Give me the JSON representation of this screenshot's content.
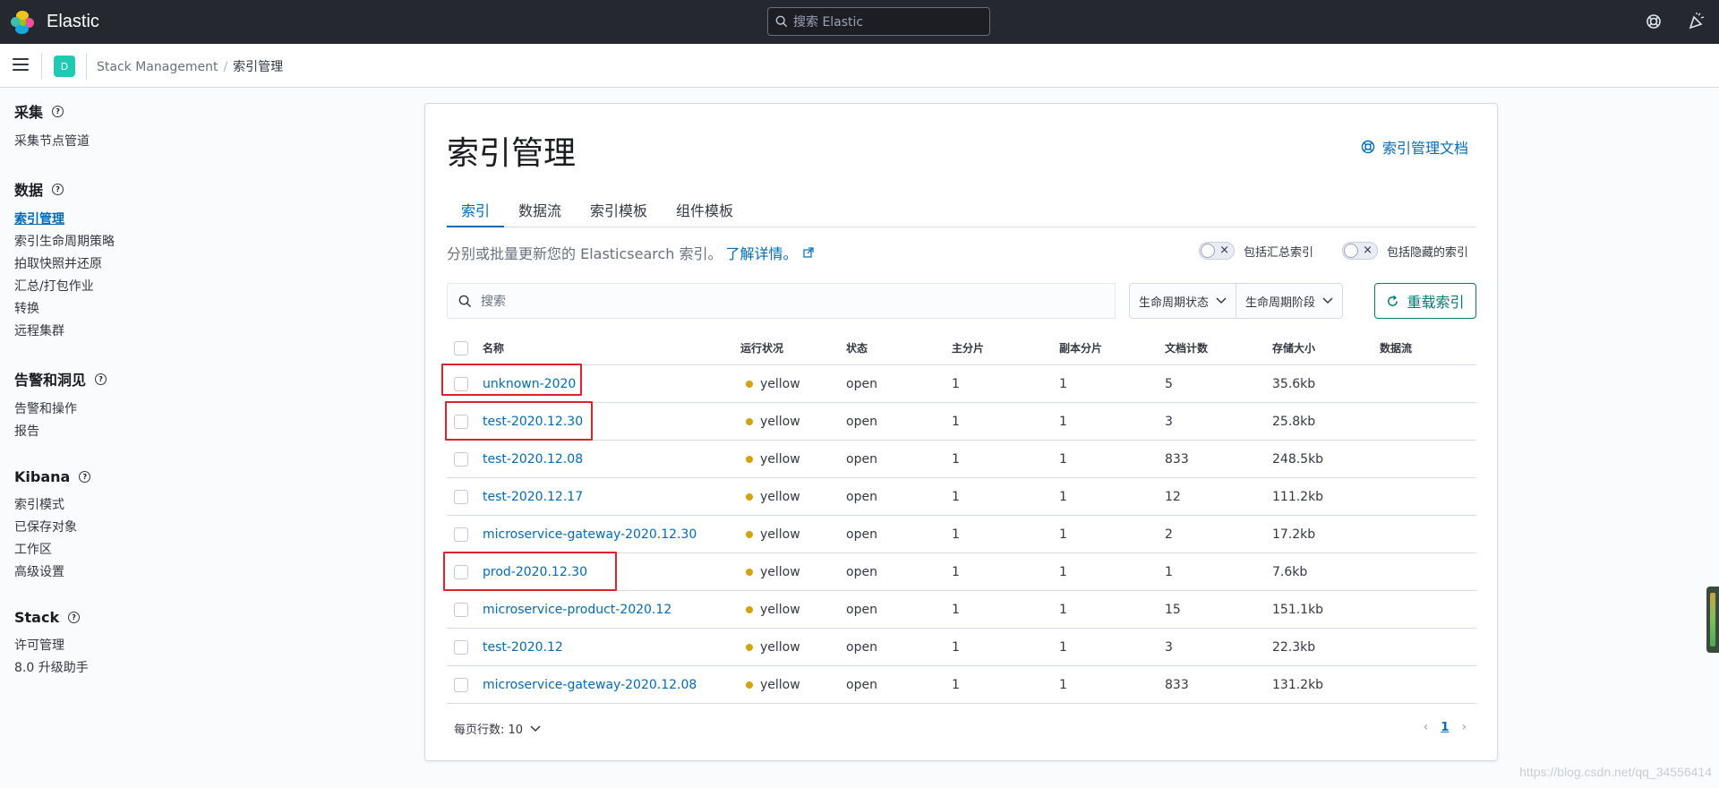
{
  "header": {
    "brand": "Elastic",
    "search_placeholder": "搜索 Elastic"
  },
  "subheader": {
    "space_initial": "D",
    "breadcrumbs": [
      "Stack Management",
      "索引管理"
    ]
  },
  "sidebar": {
    "groups": [
      {
        "title": "采集",
        "items": [
          "采集节点管道"
        ]
      },
      {
        "title": "数据",
        "items": [
          "索引管理",
          "索引生命周期策略",
          "拍取快照并还原",
          "汇总/打包作业",
          "转换",
          "远程集群"
        ]
      },
      {
        "title": "告警和洞见",
        "items": [
          "告警和操作",
          "报告"
        ]
      },
      {
        "title": "Kibana",
        "items": [
          "索引模式",
          "已保存对象",
          "工作区",
          "高级设置"
        ]
      },
      {
        "title": "Stack",
        "items": [
          "许可管理",
          "8.0 升级助手"
        ]
      }
    ],
    "active_item": "索引管理"
  },
  "main": {
    "title": "索引管理",
    "doc_link": "索引管理文档",
    "tabs": [
      "索引",
      "数据流",
      "索引模板",
      "组件模板"
    ],
    "active_tab": "索引",
    "description": "分别或批量更新您的 Elasticsearch 索引。",
    "learn_more": "了解详情。",
    "toggle_rollup": "包括汇总索引",
    "toggle_hidden": "包括隐藏的索引",
    "search_placeholder": "搜索",
    "filter_lifecycle_status": "生命周期状态",
    "filter_lifecycle_phase": "生命周期阶段",
    "reload_button": "重载索引"
  },
  "table": {
    "columns": [
      "名称",
      "运行状况",
      "状态",
      "主分片",
      "副本分片",
      "文档计数",
      "存储大小",
      "数据流"
    ],
    "rows": [
      {
        "name": "unknown-2020",
        "health": "yellow",
        "status": "open",
        "primaries": "1",
        "replicas": "1",
        "docs": "5",
        "size": "35.6kb",
        "data_stream": ""
      },
      {
        "name": "test-2020.12.30",
        "health": "yellow",
        "status": "open",
        "primaries": "1",
        "replicas": "1",
        "docs": "3",
        "size": "25.8kb",
        "data_stream": ""
      },
      {
        "name": "test-2020.12.08",
        "health": "yellow",
        "status": "open",
        "primaries": "1",
        "replicas": "1",
        "docs": "833",
        "size": "248.5kb",
        "data_stream": ""
      },
      {
        "name": "test-2020.12.17",
        "health": "yellow",
        "status": "open",
        "primaries": "1",
        "replicas": "1",
        "docs": "12",
        "size": "111.2kb",
        "data_stream": ""
      },
      {
        "name": "microservice-gateway-2020.12.30",
        "health": "yellow",
        "status": "open",
        "primaries": "1",
        "replicas": "1",
        "docs": "2",
        "size": "17.2kb",
        "data_stream": ""
      },
      {
        "name": "prod-2020.12.30",
        "health": "yellow",
        "status": "open",
        "primaries": "1",
        "replicas": "1",
        "docs": "1",
        "size": "7.6kb",
        "data_stream": ""
      },
      {
        "name": "microservice-product-2020.12",
        "health": "yellow",
        "status": "open",
        "primaries": "1",
        "replicas": "1",
        "docs": "15",
        "size": "151.1kb",
        "data_stream": ""
      },
      {
        "name": "test-2020.12",
        "health": "yellow",
        "status": "open",
        "primaries": "1",
        "replicas": "1",
        "docs": "3",
        "size": "22.3kb",
        "data_stream": ""
      },
      {
        "name": "microservice-gateway-2020.12.08",
        "health": "yellow",
        "status": "open",
        "primaries": "1",
        "replicas": "1",
        "docs": "833",
        "size": "131.2kb",
        "data_stream": ""
      }
    ],
    "highlighted_rows": [
      "unknown-2020",
      "test-2020.12.30",
      "prod-2020.12.30"
    ]
  },
  "pagination": {
    "rows_per_page": "每页行数: 10",
    "current_page": "1"
  },
  "watermark": "https://blog.csdn.net/qq_34556414",
  "colors": {
    "header_bg": "#25282f",
    "link": "#006bb8",
    "health_yellow": "#d6a10d",
    "reload_accent": "#017d73",
    "highlight_box": "#e0202a"
  }
}
